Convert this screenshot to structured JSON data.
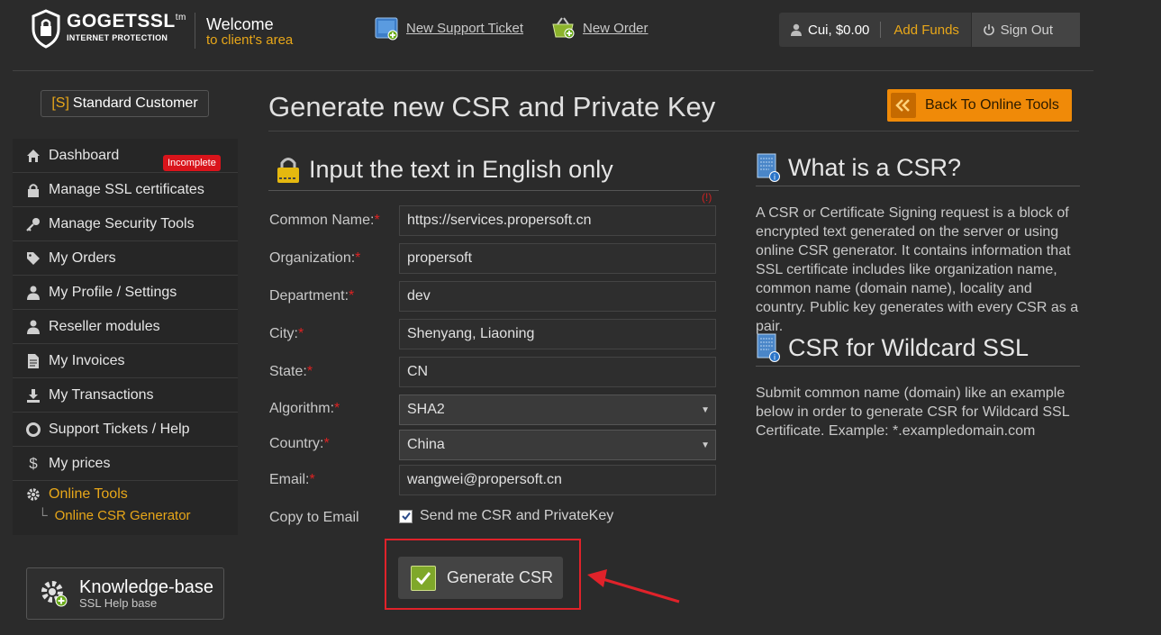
{
  "header": {
    "logo_name": "GOGETSSL",
    "logo_tm": "tm",
    "logo_tag": "INTERNET PROTECTION",
    "welcome_line1": "Welcome",
    "welcome_line2": "to client's area",
    "new_ticket": "New Support Ticket",
    "new_order": "New Order",
    "user": "Cui, $0.00",
    "add_funds": "Add Funds",
    "sign_out": "Sign Out"
  },
  "sidebar": {
    "badge_prefix": "[S]",
    "badge_label": "Standard Customer",
    "incomplete": "Incomplete",
    "items": [
      {
        "label": "Dashboard",
        "icon": "home-icon"
      },
      {
        "label": "Manage SSL certificates",
        "icon": "lock-icon"
      },
      {
        "label": "Manage Security Tools",
        "icon": "key-icon"
      },
      {
        "label": "My Orders",
        "icon": "tag-icon"
      },
      {
        "label": "My Profile / Settings",
        "icon": "user-icon"
      },
      {
        "label": "Reseller modules",
        "icon": "user-icon"
      },
      {
        "label": "My Invoices",
        "icon": "document-icon"
      },
      {
        "label": "My Transactions",
        "icon": "download-icon"
      },
      {
        "label": "Support Tickets / Help",
        "icon": "lifebuoy-icon"
      },
      {
        "label": "My prices",
        "icon": "dollar-icon"
      },
      {
        "label": "Online Tools",
        "icon": "gear-icon"
      }
    ],
    "sub_item": "Online CSR Generator",
    "kb_title": "Knowledge-base",
    "kb_sub": "SSL Help base"
  },
  "main": {
    "title": "Generate new CSR and Private Key",
    "back_button": "Back To Online Tools",
    "form_heading": "Input the text in English only",
    "excl": "(!)",
    "fields": {
      "common_name": {
        "label": "Common Name:",
        "value": "https://services.propersoft.cn"
      },
      "organization": {
        "label": "Organization:",
        "value": "propersoft"
      },
      "department": {
        "label": "Department:",
        "value": "dev"
      },
      "city": {
        "label": "City:",
        "value": "Shenyang, Liaoning"
      },
      "state": {
        "label": "State:",
        "value": "CN"
      },
      "algorithm": {
        "label": "Algorithm:",
        "value": "SHA2"
      },
      "country": {
        "label": "Country:",
        "value": "China"
      },
      "email": {
        "label": "Email:",
        "value": "wangwei@propersoft.cn"
      }
    },
    "required_mark": "*",
    "copy_label": "Copy to Email",
    "copy_checkbox": "Send me CSR and PrivateKey",
    "generate_button": "Generate CSR"
  },
  "info": {
    "csr_title": "What is a CSR?",
    "csr_text": "A CSR or Certificate Signing request is a block of encrypted text generated on the server or using online CSR generator. It contains information that SSL certificate includes like organization name, common name (domain name), locality and country. Public key generates with every CSR as a pair.",
    "wild_title": "CSR for Wildcard SSL",
    "wild_text": "Submit common name (domain) like an example below in order to generate CSR for Wildcard SSL Certificate. Example: *.exampledomain.com"
  },
  "colors": {
    "accent": "#e8a719",
    "button_orange": "#f08a08",
    "highlight_red": "#e0222a"
  }
}
